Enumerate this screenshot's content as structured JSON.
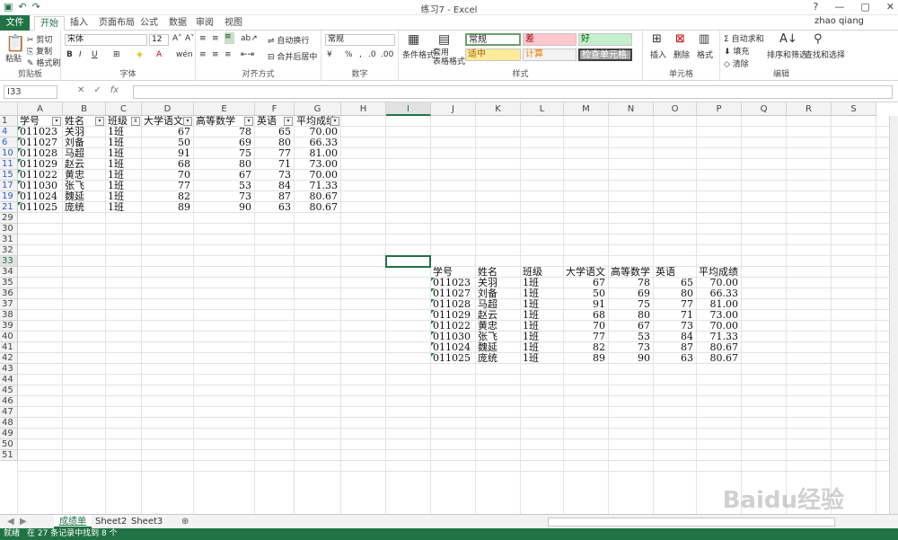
{
  "window": {
    "title": "练习7 - Excel",
    "user": "zhao qiang"
  },
  "tabs": [
    "文件",
    "开始",
    "插入",
    "页面布局",
    "公式",
    "数据",
    "审阅",
    "视图"
  ],
  "ribbon": {
    "clipboard": {
      "paste": "粘贴",
      "cut": "剪切",
      "copy": "复制",
      "format_painter": "格式刷",
      "label": "剪贴板"
    },
    "font": {
      "name": "宋体",
      "size": "12",
      "label": "字体"
    },
    "alignment": {
      "wrap": "自动换行",
      "merge": "合并后居中",
      "label": "对齐方式"
    },
    "number": {
      "format": "常规",
      "label": "数字"
    },
    "styles": {
      "cond": "条件格式",
      "table": "套用\n表格格式",
      "normal": "常规",
      "bad": "差",
      "good": "好",
      "neutral": "适中",
      "calc": "计算",
      "check": "检查单元格",
      "label": "样式"
    },
    "cells": {
      "insert": "插入",
      "delete": "删除",
      "format": "格式",
      "label": "单元格"
    },
    "editing": {
      "autosum": "自动求和",
      "fill": "填充",
      "clear": "清除",
      "sort": "排序和筛选",
      "find": "查找和选择",
      "label": "编辑"
    }
  },
  "formula_bar": {
    "name_box": "I33",
    "value": ""
  },
  "columns": [
    "A",
    "B",
    "C",
    "D",
    "E",
    "F",
    "G",
    "H",
    "I",
    "J",
    "K",
    "L",
    "M",
    "N",
    "O",
    "P",
    "Q",
    "R",
    "S"
  ],
  "row_numbers": [
    "1",
    "4",
    "6",
    "10",
    "11",
    "15",
    "17",
    "19",
    "21",
    "29",
    "30",
    "31",
    "32",
    "33",
    "34",
    "35",
    "36",
    "37",
    "38",
    "39",
    "40",
    "41",
    "42",
    "43",
    "44",
    "45",
    "46",
    "47",
    "48",
    "49",
    "50",
    "51"
  ],
  "table1": {
    "headers": [
      "学号",
      "姓名",
      "班级",
      "大学语文",
      "高等数学",
      "英语",
      "平均成绩"
    ],
    "rows": [
      [
        "011023",
        "关羽",
        "1班",
        "67",
        "78",
        "65",
        "70.00"
      ],
      [
        "011027",
        "刘备",
        "1班",
        "50",
        "69",
        "80",
        "66.33"
      ],
      [
        "011028",
        "马超",
        "1班",
        "91",
        "75",
        "77",
        "81.00"
      ],
      [
        "011029",
        "赵云",
        "1班",
        "68",
        "80",
        "71",
        "73.00"
      ],
      [
        "011022",
        "黄忠",
        "1班",
        "70",
        "67",
        "73",
        "70.00"
      ],
      [
        "011030",
        "张飞",
        "1班",
        "77",
        "53",
        "84",
        "71.33"
      ],
      [
        "011024",
        "魏延",
        "1班",
        "82",
        "73",
        "87",
        "80.67"
      ],
      [
        "011025",
        "庞统",
        "1班",
        "89",
        "90",
        "63",
        "80.67"
      ]
    ]
  },
  "table2": {
    "headers": [
      "学号",
      "姓名",
      "班级",
      "大学语文",
      "高等数学",
      "英语",
      "平均成绩"
    ],
    "rows": [
      [
        "011023",
        "关羽",
        "1班",
        "67",
        "78",
        "65",
        "70.00"
      ],
      [
        "011027",
        "刘备",
        "1班",
        "50",
        "69",
        "80",
        "66.33"
      ],
      [
        "011028",
        "马超",
        "1班",
        "91",
        "75",
        "77",
        "81.00"
      ],
      [
        "011029",
        "赵云",
        "1班",
        "68",
        "80",
        "71",
        "73.00"
      ],
      [
        "011022",
        "黄忠",
        "1班",
        "70",
        "67",
        "73",
        "70.00"
      ],
      [
        "011030",
        "张飞",
        "1班",
        "77",
        "53",
        "84",
        "71.33"
      ],
      [
        "011024",
        "魏延",
        "1班",
        "82",
        "73",
        "87",
        "80.67"
      ],
      [
        "011025",
        "庞统",
        "1班",
        "89",
        "90",
        "63",
        "80.67"
      ]
    ]
  },
  "sheets": [
    "成绩单",
    "Sheet2",
    "Sheet3"
  ],
  "status": {
    "ready": "就绪",
    "message": "在 27 条记录中找到 8 个"
  },
  "watermark": "Baidu经验"
}
